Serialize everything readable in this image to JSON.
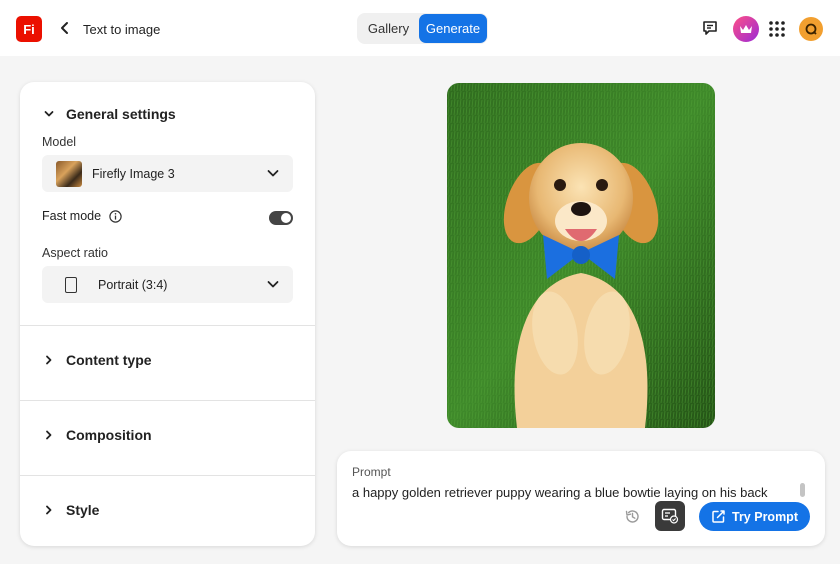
{
  "header": {
    "logo_text": "Fi",
    "page_title": "Text to image",
    "tabs": [
      {
        "label": "Gallery",
        "active": false
      },
      {
        "label": "Generate",
        "active": true
      }
    ],
    "accent_color": "#1473e6",
    "brand_color": "#eb1000"
  },
  "settings": {
    "general": {
      "title": "General settings",
      "expanded": true,
      "model_label": "Model",
      "model_value": "Firefly Image 3",
      "fast_mode_label": "Fast mode",
      "fast_mode_on": true,
      "aspect_label": "Aspect ratio",
      "aspect_value": "Portrait (3:4)"
    },
    "sections": [
      {
        "title": "Content type",
        "expanded": false
      },
      {
        "title": "Composition",
        "expanded": false
      },
      {
        "title": "Style",
        "expanded": false
      }
    ]
  },
  "prompt": {
    "label": "Prompt",
    "text": "a happy golden retriever puppy wearing a blue bowtie laying on his back",
    "button_label": "Try Prompt"
  },
  "icons": [
    "back-chevron-icon",
    "feedback-icon",
    "premium-crown-icon",
    "apps-grid-icon",
    "avatar",
    "info-icon",
    "history-icon",
    "style-reference-icon",
    "try-prompt-icon"
  ]
}
